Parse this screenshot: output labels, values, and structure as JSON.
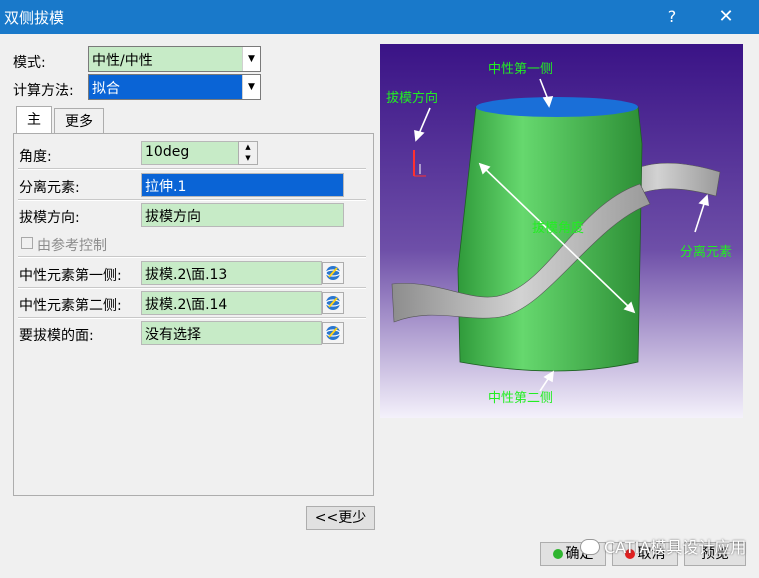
{
  "window": {
    "title": "双侧拔模",
    "help_icon": "?",
    "close_icon": "✕"
  },
  "form": {
    "mode_label": "模式:",
    "mode_value": "中性/中性",
    "calc_label": "计算方法:",
    "calc_value": "拟合"
  },
  "tabs": [
    {
      "label": "主"
    },
    {
      "label": "更多"
    }
  ],
  "main": {
    "angle_label": "角度:",
    "angle_value": "10deg",
    "parting_label": "分离元素:",
    "parting_value": "拉伸.1",
    "direction_label": "拔模方向:",
    "direction_value": "拔模方向",
    "ref_control_label": "由参考控制",
    "neutral1_label": "中性元素第一侧:",
    "neutral1_value": "拔模.2\\面.13",
    "neutral2_label": "中性元素第二侧:",
    "neutral2_value": "拔模.2\\面.14",
    "faces_label": "要拔模的面:",
    "faces_value": "没有选择"
  },
  "buttons": {
    "less": "<<更少",
    "ok": "确定",
    "cancel": "取消",
    "preview": "预览"
  },
  "preview": {
    "label_neutral1": "中性第一侧",
    "label_direction": "拔模方向",
    "label_parting": "分离元素",
    "label_angle": "拔模角度",
    "label_neutral2": "中性第二侧"
  },
  "watermark": "CATIA模具设计应用",
  "colors": {
    "titlebar": "#1979ca",
    "field_green": "#c7ebc7",
    "selection": "#0a64d6",
    "preview_label": "#22ee22"
  }
}
